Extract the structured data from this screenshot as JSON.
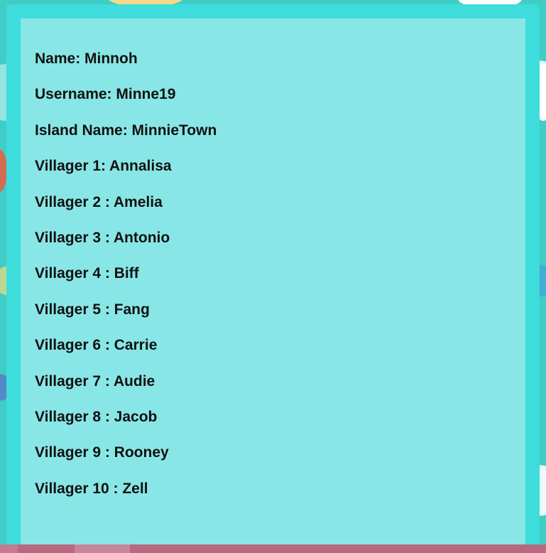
{
  "profile": {
    "rows": [
      "Name: Minnoh",
      "Username: Minne19",
      "Island Name: MinnieTown",
      "Villager 1: Annalisa",
      "Villager 2 : Amelia",
      "Villager 3 : Antonio",
      "Villager 4 : Biff",
      "Villager 5 : Fang",
      "Villager 6 : Carrie",
      "Villager 7 : Audie",
      "Villager 8 : Jacob",
      "Villager 9 : Rooney",
      "Villager 10 : Zell"
    ]
  },
  "colors": {
    "background": "#40cdc5",
    "outer_panel": "#3fdcdc",
    "inner_panel": "#89e6e6",
    "text": "#111111",
    "taskbar": "#b8687f"
  }
}
